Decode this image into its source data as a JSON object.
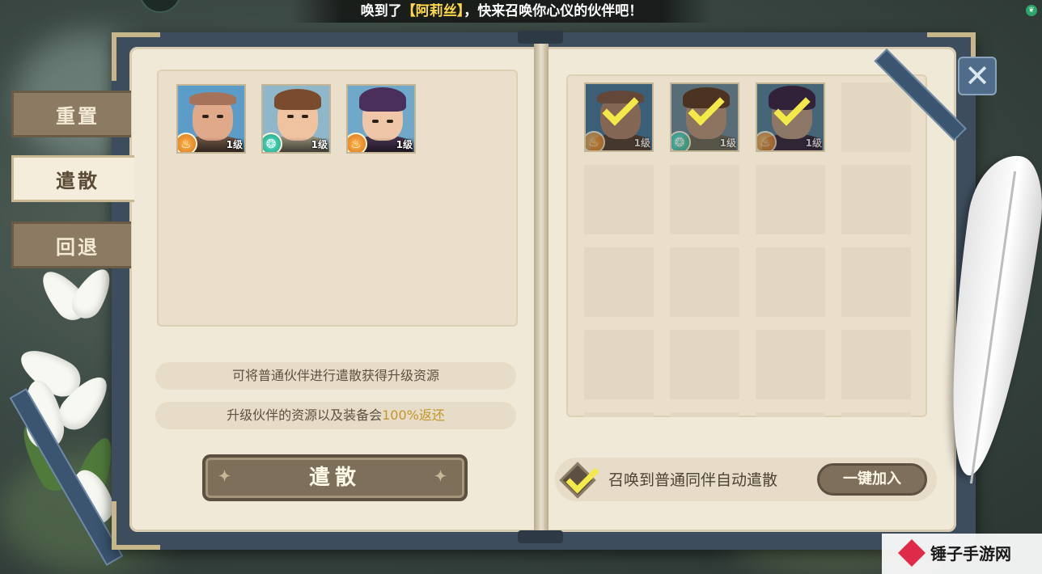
{
  "banner": {
    "text_before": "唤到了",
    "highlight": "【阿莉丝】",
    "text_after": "，快来召唤你心仪的伙伴吧！"
  },
  "tabs": [
    {
      "label": "重置",
      "active": false
    },
    {
      "label": "遣散",
      "active": true
    },
    {
      "label": "回退",
      "active": false
    }
  ],
  "owned_partners": [
    {
      "level": "1级",
      "element": "fire-icon"
    },
    {
      "level": "1级",
      "element": "wind-icon"
    },
    {
      "level": "1级",
      "element": "fire-icon"
    }
  ],
  "info": {
    "line1": "可将普通伙伴进行遣散获得升级资源",
    "line2_prefix": "升级伙伴的资源以及装备会",
    "line2_highlight": "100%返还"
  },
  "dismiss_button": "遣散",
  "selected_partners": [
    {
      "level": "1级",
      "element": "fire-icon",
      "checked": true
    },
    {
      "level": "1级",
      "element": "wind-icon",
      "checked": true
    },
    {
      "level": "1级",
      "element": "fire-icon",
      "checked": true
    }
  ],
  "auto_dismiss": {
    "checked": true,
    "label": "召唤到普通同伴自动遣散"
  },
  "add_all_button": "一键加入",
  "close_icon": "✕",
  "watermark": "锤子手游网",
  "colors": {
    "accent_gold": "#c4962a",
    "check_yellow": "#f3ea4a",
    "page": "#f1e9d8",
    "button": "#7e6f5a"
  }
}
